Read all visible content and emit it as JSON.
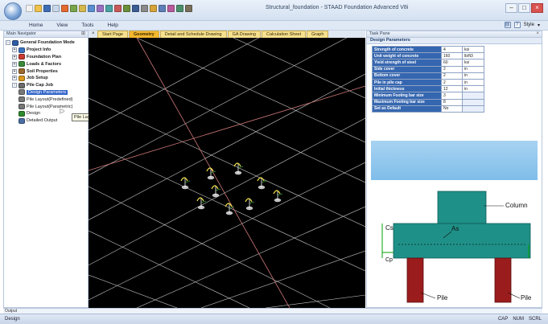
{
  "window": {
    "title": "Structural_foundation - STAAD Foundation Advanced V8i",
    "style_label": "Style"
  },
  "menu": [
    "Home",
    "View",
    "Tools",
    "Help"
  ],
  "navigation": {
    "title": "Main Navigator",
    "items": [
      {
        "label": "General Foundation Mode",
        "level": 0,
        "expander": "-",
        "icon_color": "#2f5ea8",
        "bold": true,
        "selected": false
      },
      {
        "label": "Project Info",
        "level": 1,
        "expander": "+",
        "icon_color": "#3b73c4",
        "bold": true,
        "selected": false
      },
      {
        "label": "Foundation Plan",
        "level": 1,
        "expander": "+",
        "icon_color": "#c8382e",
        "bold": true,
        "selected": false
      },
      {
        "label": "Loads & Factors",
        "level": 1,
        "expander": "+",
        "icon_color": "#3a8a3a",
        "bold": true,
        "selected": false
      },
      {
        "label": "Soil Properties",
        "level": 1,
        "expander": "+",
        "icon_color": "#9b6a2e",
        "bold": true,
        "selected": false
      },
      {
        "label": "Job Setup",
        "level": 1,
        "expander": "+",
        "icon_color": "#d99a1c",
        "bold": true,
        "selected": false
      },
      {
        "label": "Pile Cap Job",
        "level": 1,
        "expander": "-",
        "icon_color": "#6b6b6b",
        "bold": true,
        "selected": false
      },
      {
        "label": "Design Parameters",
        "level": 2,
        "expander": "",
        "icon_color": "#777777",
        "bold": false,
        "selected": true
      },
      {
        "label": "Pile Layout(Predefined)",
        "level": 2,
        "expander": "",
        "icon_color": "#777777",
        "bold": false,
        "selected": false
      },
      {
        "label": "Pile Layout(Parametric)",
        "level": 2,
        "expander": "",
        "icon_color": "#777777",
        "bold": false,
        "selected": false
      },
      {
        "label": "Design",
        "level": 2,
        "expander": "",
        "icon_color": "#2e8b2e",
        "bold": false,
        "selected": false
      },
      {
        "label": "Detailed Output",
        "level": 2,
        "expander": "",
        "icon_color": "#4a6fa5",
        "bold": false,
        "selected": false
      }
    ],
    "tooltip": "Pile Layout(Parametric)"
  },
  "tabs": [
    {
      "label": "Start Page",
      "active": false
    },
    {
      "label": "Geometry",
      "active": true
    },
    {
      "label": "Detail and Schedule Drawing",
      "active": false
    },
    {
      "label": "GA Drawing",
      "active": false
    },
    {
      "label": "Calculation Sheet",
      "active": false
    },
    {
      "label": "Graph",
      "active": false
    }
  ],
  "task_pane": {
    "title": "Task Pane",
    "section_title": "Design Parameters",
    "params": [
      {
        "name": "Strength of concrete",
        "value": "4",
        "unit": "ksi"
      },
      {
        "name": "Unit weight of concrete",
        "value": "160",
        "unit": "lb/ft3"
      },
      {
        "name": "Yield strength of steel",
        "value": "60",
        "unit": "ksi"
      },
      {
        "name": "Side cover",
        "value": "2",
        "unit": "in"
      },
      {
        "name": "Bottom cover",
        "value": "2",
        "unit": "in"
      },
      {
        "name": "Pile in pile cap",
        "value": "2",
        "unit": "in"
      },
      {
        "name": "Initial thickness",
        "value": "12",
        "unit": "in"
      },
      {
        "name": "Minimum Footing bar size",
        "value": "3",
        "unit": ""
      },
      {
        "name": "Maximum Footing bar size",
        "value": "8",
        "unit": ""
      },
      {
        "name": "Set as Default",
        "value": "No",
        "unit": ""
      }
    ],
    "diagram_labels": {
      "column": "Column",
      "cs": "Cs",
      "as": "As",
      "cp": "Cp",
      "pile_left": "Pile",
      "pile_right": "Pile"
    },
    "colors": {
      "cap": "#1f9088",
      "pile": "#9b1c1c",
      "dim": "#00a000"
    }
  },
  "output": {
    "title": "Output"
  },
  "status": {
    "left": "Design",
    "right": [
      "CAP",
      "NUM",
      "SCRL"
    ]
  }
}
